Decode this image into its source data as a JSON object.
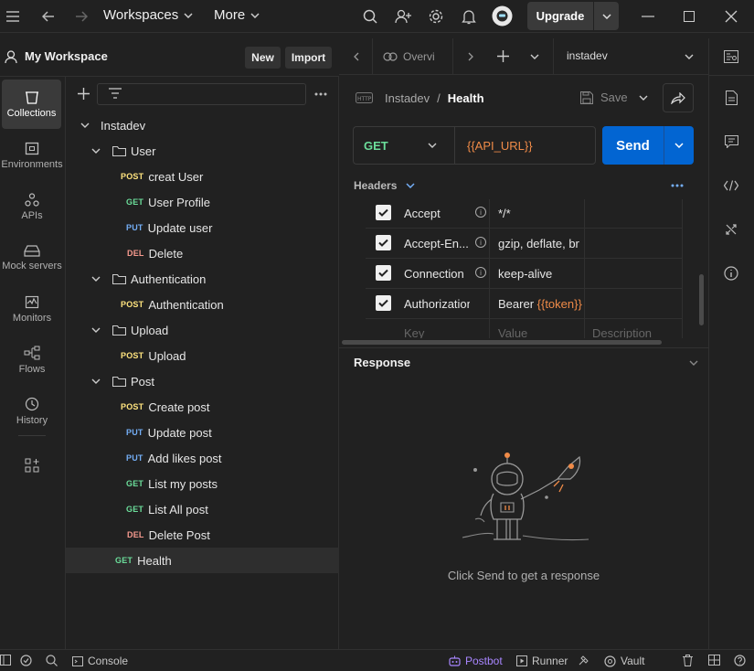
{
  "topbar": {
    "workspaces_label": "Workspaces",
    "more_label": "More",
    "upgrade_label": "Upgrade"
  },
  "workspace": {
    "title": "My Workspace",
    "new_label": "New",
    "import_label": "Import"
  },
  "rail": {
    "items": [
      {
        "label": "Collections",
        "icon": "collections-icon"
      },
      {
        "label": "Environments",
        "icon": "environments-icon"
      },
      {
        "label": "APIs",
        "icon": "apis-icon"
      },
      {
        "label": "Mock servers",
        "icon": "mock-servers-icon"
      },
      {
        "label": "Monitors",
        "icon": "monitors-icon"
      },
      {
        "label": "Flows",
        "icon": "flows-icon"
      },
      {
        "label": "History",
        "icon": "history-icon"
      }
    ]
  },
  "tree": {
    "collection": "Instadev",
    "folders": {
      "user": "User",
      "authentication": "Authentication",
      "upload": "Upload",
      "post": "Post"
    },
    "requests": [
      {
        "method": "POST",
        "name": "creat User"
      },
      {
        "method": "GET",
        "name": "User Profile"
      },
      {
        "method": "PUT",
        "name": "Update user"
      },
      {
        "method": "DEL",
        "name": "Delete"
      },
      {
        "method": "POST",
        "name": "Authentication"
      },
      {
        "method": "POST",
        "name": "Upload"
      },
      {
        "method": "POST",
        "name": "Create post"
      },
      {
        "method": "PUT",
        "name": "Update post"
      },
      {
        "method": "PUT",
        "name": "Add likes post"
      },
      {
        "method": "GET",
        "name": "List my posts"
      },
      {
        "method": "GET",
        "name": "List All post"
      },
      {
        "method": "DEL",
        "name": "Delete Post"
      },
      {
        "method": "GET",
        "name": "Health"
      }
    ]
  },
  "tabs": {
    "overview_label": "Overvi",
    "environment": "instadev"
  },
  "request": {
    "breadcrumb_collection": "Instadev",
    "breadcrumb_sep": "/",
    "name": "Health",
    "save_label": "Save",
    "method": "GET",
    "url": "{{API_URL}}",
    "send_label": "Send"
  },
  "headers_section": {
    "label": "Headers",
    "rows": [
      {
        "key": "Accept",
        "value_text": "*/*",
        "value_token": ""
      },
      {
        "key": "Accept-En...",
        "value_text": "gzip, deflate, br",
        "value_token": ""
      },
      {
        "key": "Connection",
        "value_text": "keep-alive",
        "value_token": ""
      },
      {
        "key": "Authorization",
        "value_text": "Bearer ",
        "value_token": "{{token}}"
      }
    ],
    "placeholder_key": "Key",
    "placeholder_value": "Value",
    "placeholder_description": "Description"
  },
  "response": {
    "title": "Response",
    "empty_text": "Click Send to get a response"
  },
  "statusbar": {
    "console_label": "Console",
    "postbot_label": "Postbot",
    "runner_label": "Runner",
    "vault_label": "Vault"
  },
  "colors": {
    "accent_send": "#0265d2",
    "method_get": "#6bdd9a",
    "method_post": "#ffe47e",
    "method_put": "#74aef6",
    "method_del": "#f79a8e",
    "token": "#f08b48",
    "postbot": "#a886ff"
  }
}
